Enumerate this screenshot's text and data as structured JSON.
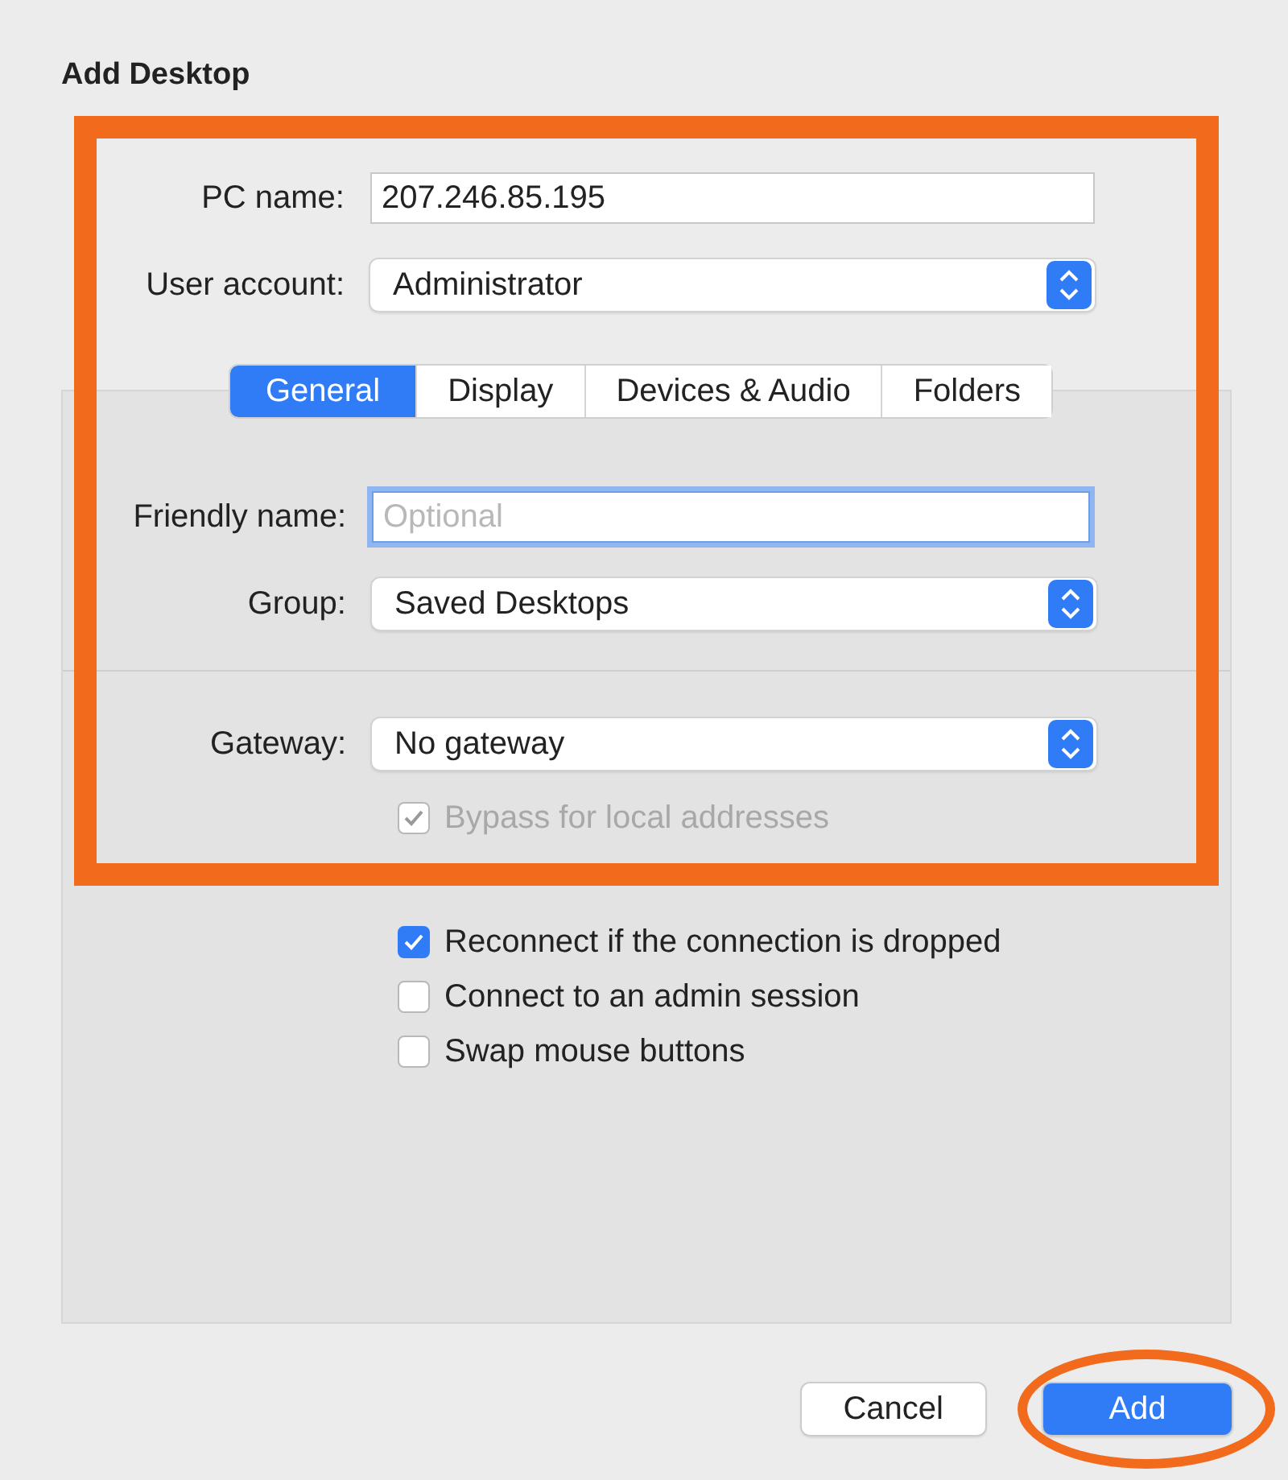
{
  "window": {
    "title": "Add Desktop"
  },
  "top_fields": [
    {
      "label": "PC name:",
      "kind": "text",
      "value": "207.246.85.195"
    },
    {
      "label": "User account:",
      "kind": "popup",
      "value": "Administrator"
    }
  ],
  "tabs": [
    {
      "label": "General",
      "selected": true
    },
    {
      "label": "Display",
      "selected": false
    },
    {
      "label": "Devices & Audio",
      "selected": false
    },
    {
      "label": "Folders",
      "selected": false
    }
  ],
  "general_fields": [
    {
      "label": "Friendly name:",
      "kind": "text",
      "placeholder": "Optional",
      "focused": true
    },
    {
      "label": "Group:",
      "kind": "popup",
      "value": "Saved Desktops"
    }
  ],
  "gateway": {
    "label": "Gateway:",
    "value": "No gateway"
  },
  "bypass": {
    "label": "Bypass for local addresses",
    "checked": true,
    "disabled": true
  },
  "options": [
    {
      "label": "Reconnect if the connection is dropped",
      "checked": true
    },
    {
      "label": "Connect to an admin session",
      "checked": false
    },
    {
      "label": "Swap mouse buttons",
      "checked": false
    }
  ],
  "buttons": [
    {
      "label": "Cancel",
      "default": false
    },
    {
      "label": "Add",
      "default": true
    }
  ],
  "annotations": [
    {
      "kind": "rectangle"
    },
    {
      "kind": "ellipse"
    }
  ]
}
